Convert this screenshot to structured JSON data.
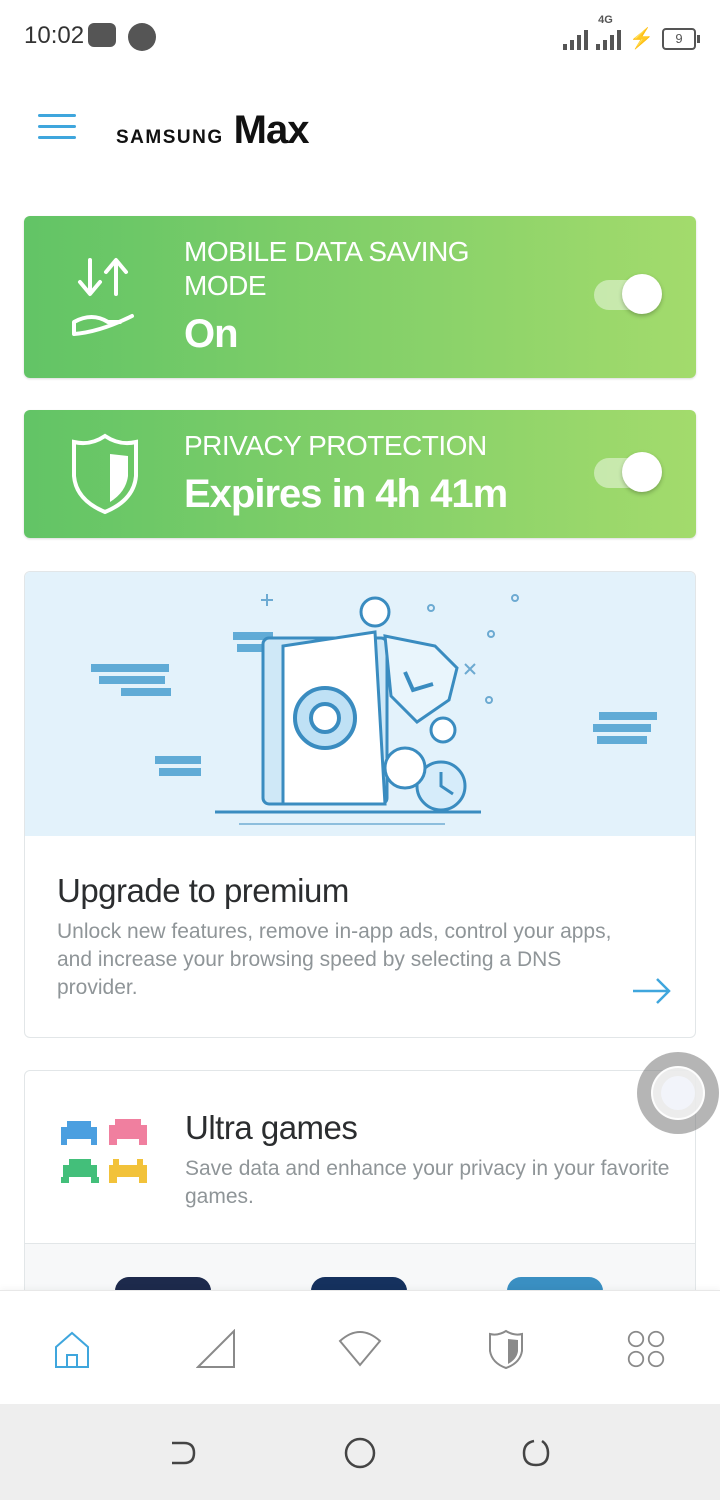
{
  "status_bar": {
    "time": "10:02",
    "network_label": "4G",
    "battery_level": "9"
  },
  "app_bar": {
    "brand_primary": "SAMSUNG",
    "brand_secondary": "Max"
  },
  "features": {
    "data_saving": {
      "title_line1": "MOBILE DATA SAVING",
      "title_line2": "MODE",
      "value": "On",
      "enabled": true
    },
    "privacy": {
      "title": "PRIVACY PROTECTION",
      "value": "Expires in 4h 41m",
      "enabled": true
    }
  },
  "premium": {
    "title": "Upgrade to premium",
    "description": "Unlock new features, remove in-app ads, control your apps, and increase your browsing speed by selecting a DNS provider."
  },
  "games": {
    "title": "Ultra games",
    "description": "Save data and enhance your privacy in your favorite games."
  },
  "bottom_tabs": [
    "home-icon",
    "signal-icon",
    "wifi-icon",
    "shield-icon",
    "apps-grid-icon"
  ],
  "colors": {
    "accent": "#3fa6dd",
    "green_start": "#62c466",
    "green_end": "#a3db6c"
  }
}
